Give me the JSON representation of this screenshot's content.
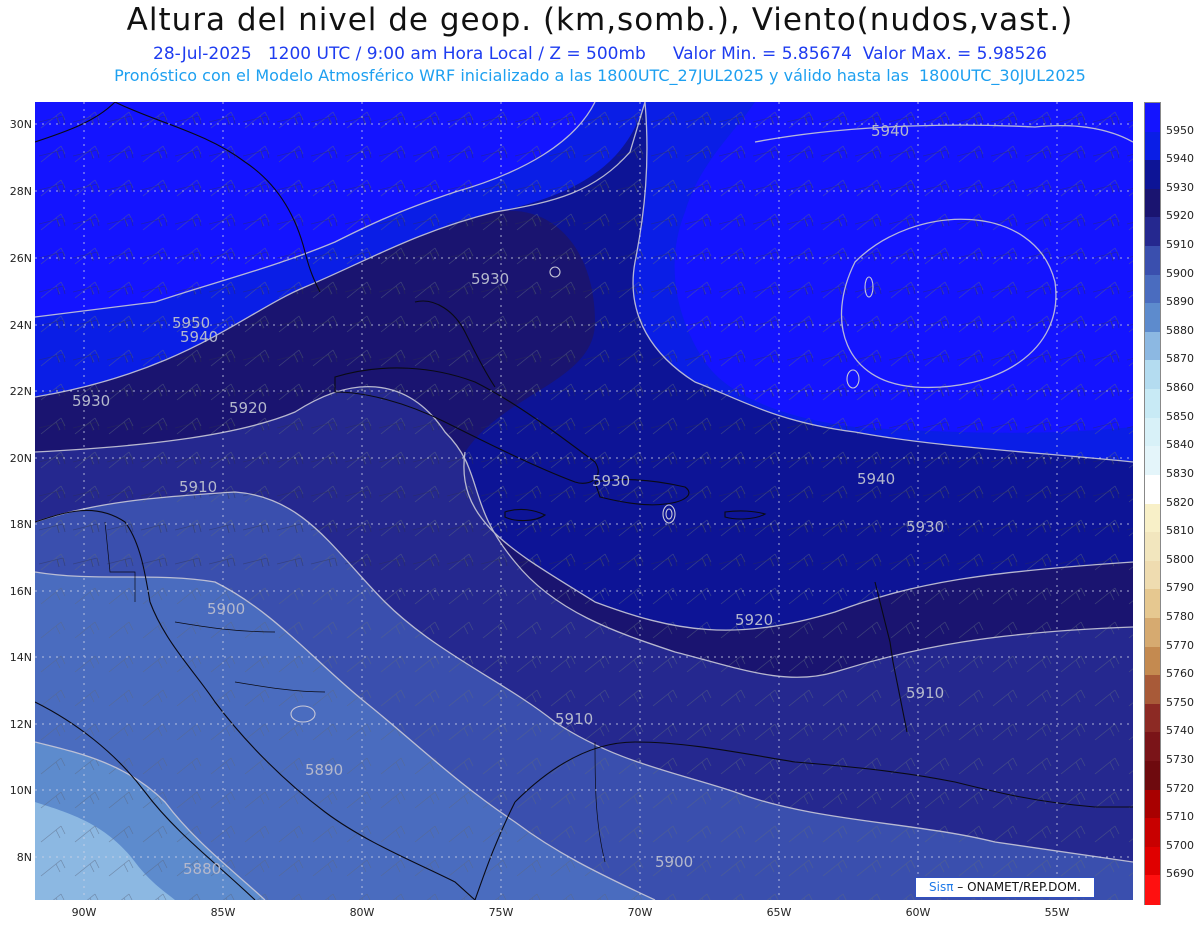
{
  "header": {
    "title": "Altura del nivel de geop. (km,somb.), Viento(nudos,vast.)",
    "subtitle1": "28-Jul-2025   1200 UTC / 9:00 am Hora Local / Z = 500mb     Valor Min. = 5.85674  Valor Max. = 5.98526",
    "subtitle2": "Pronóstico con el Modelo Atmosférico WRF inicializado a las 1800UTC_27JUL2025 y válido hasta las  1800UTC_30JUL2025"
  },
  "axes": {
    "lat_labels": [
      "30N",
      "28N",
      "26N",
      "24N",
      "22N",
      "20N",
      "18N",
      "16N",
      "14N",
      "12N",
      "10N",
      "8N"
    ],
    "lon_labels": [
      "90W",
      "85W",
      "80W",
      "75W",
      "70W",
      "65W",
      "60W",
      "55W"
    ]
  },
  "colorbar": {
    "labels": [
      "5950",
      "5940",
      "5930",
      "5920",
      "5910",
      "5900",
      "5890",
      "5880",
      "5870",
      "5860",
      "5850",
      "5840",
      "5830",
      "5820",
      "5810",
      "5800",
      "5790",
      "5780",
      "5770",
      "5760",
      "5750",
      "5740",
      "5730",
      "5720",
      "5710",
      "5700",
      "5690"
    ],
    "colors": [
      "#1414ff",
      "#0a1ee6",
      "#0d1496",
      "#1a1470",
      "#25288f",
      "#3a4fae",
      "#4a6cbf",
      "#5d8bcd",
      "#8cb8e2",
      "#b4dcf0",
      "#c8eaf5",
      "#d8f1f8",
      "#e4f5fa",
      "#ffffff",
      "#f8f0c8",
      "#f2e6be",
      "#efdcb0",
      "#e6c890",
      "#d6aa70",
      "#c48a50",
      "#a85a38",
      "#8c2a24",
      "#7a1418",
      "#6e0a0e",
      "#a80000",
      "#c80000",
      "#e00000",
      "#ff1010"
    ]
  },
  "contours": {
    "labels": [
      "5940",
      "5950",
      "5940",
      "5930",
      "5930",
      "5920",
      "5910",
      "5930",
      "5940",
      "5930",
      "5900",
      "5920",
      "5910",
      "5910",
      "5890",
      "5880",
      "5900"
    ]
  },
  "credit": {
    "brand": "Sisπ",
    "org": "– ONAMET/REP.DOM."
  }
}
